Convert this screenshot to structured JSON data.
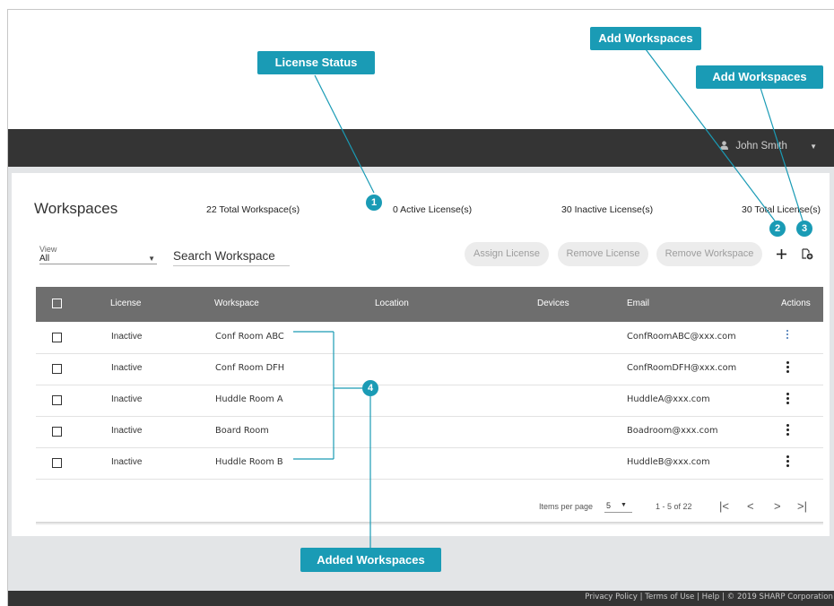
{
  "header": {
    "user_name": "John Smith",
    "user_icon": "person-icon",
    "caret_icon": "chevron-down-icon"
  },
  "page": {
    "title": "Workspaces",
    "stats": {
      "total_workspaces": "22 Total Workspace(s)",
      "active_licenses": "0 Active License(s)",
      "inactive_licenses": "30 Inactive License(s)",
      "total_licenses": "30 Total License(s)"
    }
  },
  "filters": {
    "view_label": "View",
    "view_value": "All",
    "search_placeholder": "Search Workspace"
  },
  "toolbar": {
    "assign_license": "Assign License",
    "remove_license": "Remove License",
    "remove_workspace": "Remove Workspace",
    "add_icon": "plus-icon",
    "import_icon": "file-add-icon"
  },
  "table": {
    "columns": [
      "License",
      "Workspace",
      "Location",
      "Devices",
      "Email",
      "Actions"
    ],
    "rows": [
      {
        "license": "Inactive",
        "workspace": "Conf Room ABC",
        "location": "",
        "devices": "",
        "email": "ConfRoomABC@xxx.com"
      },
      {
        "license": "Inactive",
        "workspace": "Conf Room DFH",
        "location": "",
        "devices": "",
        "email": "ConfRoomDFH@xxx.com"
      },
      {
        "license": "Inactive",
        "workspace": "Huddle Room A",
        "location": "",
        "devices": "",
        "email": "HuddleA@xxx.com"
      },
      {
        "license": "Inactive",
        "workspace": "Board Room",
        "location": "",
        "devices": "",
        "email": "Boadroom@xxx.com"
      },
      {
        "license": "Inactive",
        "workspace": "Huddle Room B",
        "location": "",
        "devices": "",
        "email": "HuddleB@xxx.com"
      }
    ]
  },
  "pagination": {
    "items_per_page_label": "Items per page",
    "items_per_page_value": "5",
    "range": "1 - 5 of 22"
  },
  "footer": {
    "text": "Privacy Policy  |  Terms of Use  |  Help  |  © 2019 SHARP Corporation"
  },
  "callouts": {
    "license_status": "License Status",
    "add_workspaces_1": "Add Workspaces",
    "add_workspaces_2": "Add Workspaces",
    "added_workspaces": "Added Workspaces",
    "badges": [
      "1",
      "2",
      "3",
      "4"
    ]
  },
  "colors": {
    "callout": "#1a9bb5",
    "header_bar": "#343434",
    "table_header": "#6e6e6e",
    "background": "#e3e5e7"
  }
}
